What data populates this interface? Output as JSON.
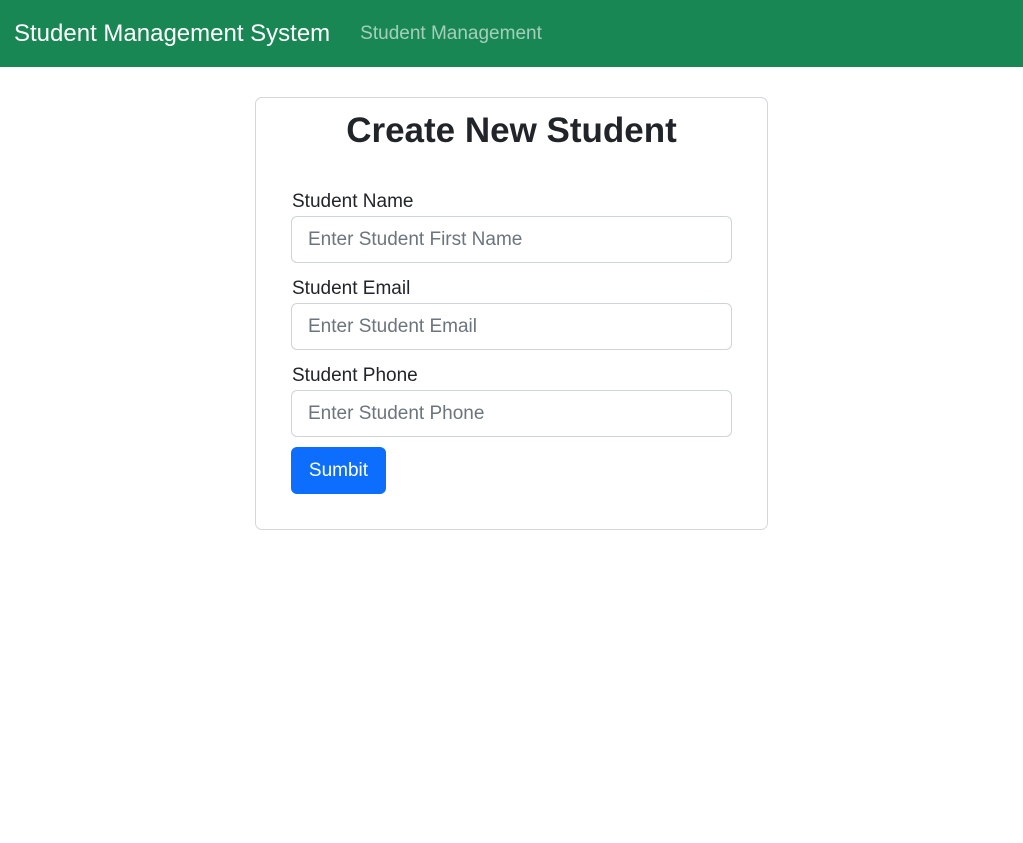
{
  "navbar": {
    "brand": "Student Management System",
    "link": "Student Management",
    "color": "#198754"
  },
  "form": {
    "title": "Create New Student",
    "fields": [
      {
        "label": "Student Name",
        "placeholder": "Enter Student First Name",
        "value": ""
      },
      {
        "label": "Student Email",
        "placeholder": "Enter Student Email",
        "value": ""
      },
      {
        "label": "Student Phone",
        "placeholder": "Enter Student Phone",
        "value": ""
      }
    ],
    "submit_label": "Sumbit",
    "submit_color": "#0d6efd"
  }
}
